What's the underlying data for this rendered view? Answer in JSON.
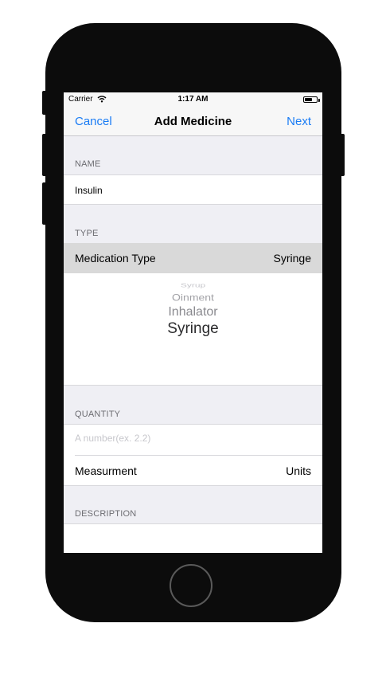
{
  "status_bar": {
    "carrier": "Carrier",
    "time": "1:17 AM"
  },
  "nav": {
    "cancel_label": "Cancel",
    "title": "Add Medicine",
    "next_label": "Next"
  },
  "name_section": {
    "header": "NAME",
    "value": "Insulin"
  },
  "type_section": {
    "header": "TYPE",
    "row_label": "Medication Type",
    "selected_value": "Syringe",
    "picker_options": [
      "Syrup",
      "Oinment",
      "Inhalator",
      "Syringe"
    ]
  },
  "quantity_section": {
    "header": "QUANTITY",
    "placeholder": "A number(ex. 2.2)",
    "measurement_label": "Measurment",
    "measurement_value": "Units"
  },
  "description_section": {
    "header": "DESCRIPTION"
  },
  "colors": {
    "accent": "#1a7cf5",
    "background": "#efeff4",
    "selected_row": "#d9d9d9"
  }
}
